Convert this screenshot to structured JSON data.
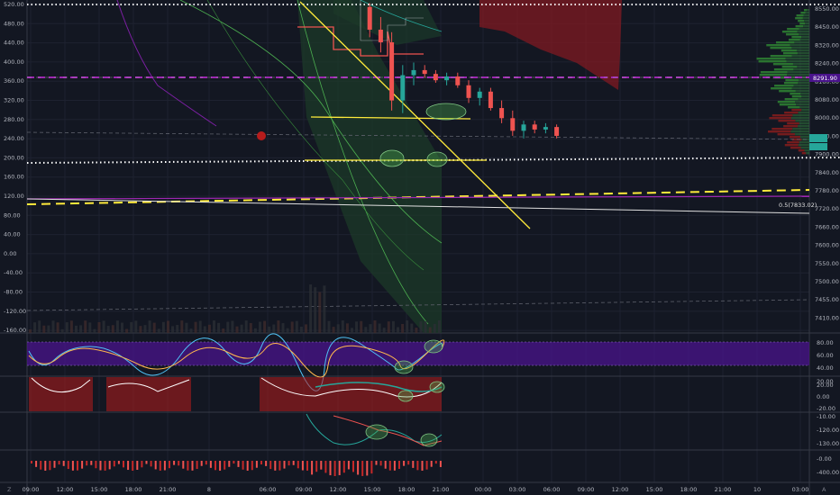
{
  "chart_data": {
    "type": "candlestick",
    "panes": {
      "main": {
        "left_axis": {
          "ticks": [
            "520.00",
            "480.00",
            "440.00",
            "400.00",
            "360.00",
            "320.00",
            "280.00",
            "240.00",
            "200.00",
            "160.00",
            "120.00",
            "80.00",
            "40.00",
            "0.00",
            "-40.00",
            "-80.00",
            "-120.00",
            "-160.00"
          ],
          "range": [
            -165,
            525
          ]
        },
        "right_axis": {
          "ticks": [
            "8550.00",
            "8450.00",
            "8320.00",
            "8240.00",
            "8160.00",
            "8080.00",
            "8000.00",
            "7950.00",
            "7900.00",
            "7840.00",
            "7780.00",
            "7720.00",
            "7660.00",
            "7600.00",
            "7550.00",
            "7500.00",
            "7455.00",
            "7410.00"
          ]
        },
        "price_tags": [
          "8291.90"
        ],
        "fib_label": "0.5(7833.02)",
        "candles": [
          {
            "t": 6,
            "o": 8560,
            "h": 8575,
            "l": 8440,
            "c": 8470
          },
          {
            "t": 7,
            "o": 8470,
            "h": 8520,
            "l": 8380,
            "c": 8420
          },
          {
            "t": 8,
            "o": 8420,
            "h": 8460,
            "l": 8150,
            "c": 8190
          },
          {
            "t": 9,
            "o": 8190,
            "h": 8330,
            "l": 8140,
            "c": 8290
          },
          {
            "t": 10,
            "o": 8290,
            "h": 8340,
            "l": 8250,
            "c": 8310
          },
          {
            "t": 11,
            "o": 8310,
            "h": 8330,
            "l": 8280,
            "c": 8295
          },
          {
            "t": 12,
            "o": 8295,
            "h": 8310,
            "l": 8260,
            "c": 8270
          },
          {
            "t": 13,
            "o": 8270,
            "h": 8300,
            "l": 8250,
            "c": 8285
          },
          {
            "t": 14,
            "o": 8285,
            "h": 8300,
            "l": 8240,
            "c": 8250
          },
          {
            "t": 15,
            "o": 8250,
            "h": 8270,
            "l": 8180,
            "c": 8200
          },
          {
            "t": 16,
            "o": 8200,
            "h": 8240,
            "l": 8170,
            "c": 8225
          },
          {
            "t": 17,
            "o": 8225,
            "h": 8240,
            "l": 8150,
            "c": 8160
          },
          {
            "t": 18,
            "o": 8160,
            "h": 8190,
            "l": 8100,
            "c": 8120
          },
          {
            "t": 19,
            "o": 8120,
            "h": 8150,
            "l": 8050,
            "c": 8070
          },
          {
            "t": 20,
            "o": 8070,
            "h": 8110,
            "l": 8040,
            "c": 8095
          },
          {
            "t": 21,
            "o": 8095,
            "h": 8110,
            "l": 8060,
            "c": 8075
          },
          {
            "t": 22,
            "o": 8075,
            "h": 8100,
            "l": 8060,
            "c": 8085
          },
          {
            "t": 23,
            "o": 8085,
            "h": 8095,
            "l": 8040,
            "c": 8050
          }
        ]
      },
      "stoch_rsi": {
        "ticks": [
          "80.00",
          "60.00",
          "40.00",
          "20.00"
        ]
      },
      "macd": {
        "ticks": [
          "20.00",
          "0.00",
          "-20.00"
        ]
      },
      "oscillator": {
        "ticks": [
          "-10.00",
          "-120.00",
          "-130.00"
        ]
      },
      "histogram": {
        "ticks": [
          "-0.00",
          "-400.00"
        ]
      }
    },
    "x_axis": {
      "ticks": [
        "09:00",
        "12:00",
        "15:00",
        "18:00",
        "21:00",
        "8",
        "06:00",
        "09:00",
        "12:00",
        "15:00",
        "18:00",
        "21:00",
        "00:00",
        "03:00",
        "06:00",
        "09:00",
        "12:00",
        "15:00",
        "18:00",
        "21:00",
        "10",
        "03:00"
      ]
    },
    "tv_logo": "Z",
    "auto_label": "A"
  }
}
